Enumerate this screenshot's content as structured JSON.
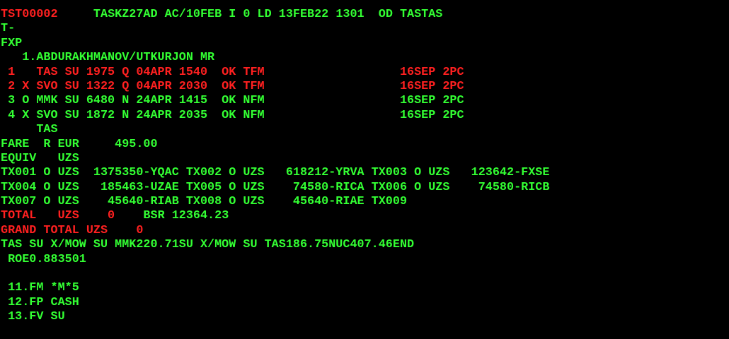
{
  "colors": {
    "green": "#33ff33",
    "red": "#ff2020",
    "background": "#000000"
  },
  "lines": [
    {
      "segments": [
        {
          "text": "TST00002",
          "color": "r"
        },
        {
          "text": "     TASKZ27AD AC/10FEB I 0 LD 13FEB22 1301  OD TASTAS",
          "color": "g"
        }
      ]
    },
    {
      "segments": [
        {
          "text": "T-",
          "color": "g"
        }
      ]
    },
    {
      "segments": [
        {
          "text": "FXP",
          "color": "g"
        }
      ]
    },
    {
      "segments": [
        {
          "text": "   1.ABDURAKHMANOV/UTKURJON MR",
          "color": "g"
        }
      ]
    },
    {
      "segments": [
        {
          "text": " 1   TAS SU 1975 Q 04APR 1540  OK TFM                   16SEP 2PC",
          "color": "r"
        }
      ]
    },
    {
      "segments": [
        {
          "text": " 2 X SVO SU 1322 Q 04APR 2030  OK TFM                   16SEP 2PC",
          "color": "r"
        }
      ]
    },
    {
      "segments": [
        {
          "text": " 3 O MMK SU 6480 N 24APR 1415  OK NFM                   16SEP 2PC",
          "color": "g"
        }
      ]
    },
    {
      "segments": [
        {
          "text": " 4 X SVO SU 1872 N 24APR 2035  OK NFM                   16SEP 2PC",
          "color": "g"
        }
      ]
    },
    {
      "segments": [
        {
          "text": "     TAS",
          "color": "g"
        }
      ]
    },
    {
      "segments": [
        {
          "text": "FARE  R EUR     495.00",
          "color": "g"
        }
      ]
    },
    {
      "segments": [
        {
          "text": "EQUIV   UZS",
          "color": "g"
        }
      ]
    },
    {
      "segments": [
        {
          "text": "TX001 O UZS  1375350-YQAC TX002 O UZS   618212-YRVA TX003 O UZS   123642-FXSE",
          "color": "g"
        }
      ]
    },
    {
      "segments": [
        {
          "text": "TX004 O UZS   185463-UZAE TX005 O UZS    74580-RICA TX006 O UZS    74580-RICB",
          "color": "g"
        }
      ]
    },
    {
      "segments": [
        {
          "text": "TX007 O UZS    45640-RIAB TX008 O UZS    45640-RIAE TX009",
          "color": "g"
        }
      ]
    },
    {
      "segments": [
        {
          "text": "TOTAL   UZS    0",
          "color": "r"
        },
        {
          "text": "    BSR 12364.23",
          "color": "g"
        }
      ]
    },
    {
      "segments": [
        {
          "text": "GRAND TOTAL UZS    0",
          "color": "r"
        }
      ]
    },
    {
      "segments": [
        {
          "text": "TAS SU X/MOW SU MMK220.71SU X/MOW SU TAS186.75NUC407.46END",
          "color": "g"
        }
      ]
    },
    {
      "segments": [
        {
          "text": " ROE0.883501",
          "color": "g"
        }
      ]
    },
    {
      "segments": [
        {
          "text": "",
          "color": "g"
        }
      ]
    },
    {
      "segments": [
        {
          "text": " 11.FM *M*5",
          "color": "g"
        }
      ]
    },
    {
      "segments": [
        {
          "text": " 12.FP CASH",
          "color": "g"
        }
      ]
    },
    {
      "segments": [
        {
          "text": " 13.FV SU",
          "color": "g"
        }
      ]
    }
  ]
}
